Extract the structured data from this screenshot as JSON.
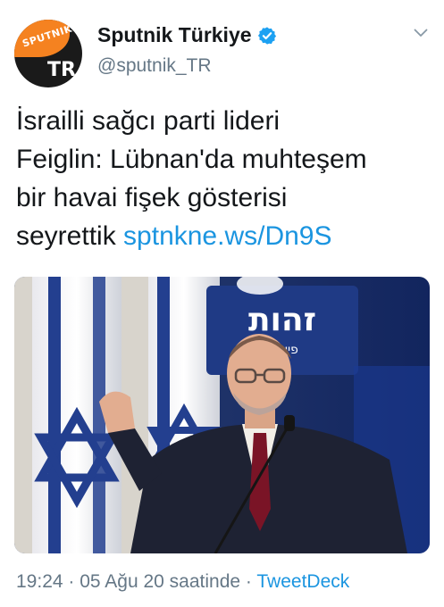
{
  "account": {
    "display_name": "Sputnik Türkiye",
    "handle": "@sputnik_TR",
    "avatar_logo_text": "SPUTNIK",
    "avatar_badge": "TR",
    "verified": true
  },
  "tweet": {
    "text_lines": [
      "İsrailli sağcı parti lideri",
      "Feiglin: Lübnan'da muhteşem",
      "bir havai fişek gösterisi"
    ],
    "last_line_prefix": "seyrettik",
    "link_text": "sptnkne.ws/Dn9S"
  },
  "photo": {
    "banner_text": "זהות",
    "banner_subtext": "פייגלין"
  },
  "meta": {
    "time": "19:24",
    "separator": "·",
    "date": "05 Ağu 20 saatinde",
    "source": "TweetDeck"
  },
  "colors": {
    "link": "#1b95e0",
    "secondary": "#657786",
    "verified": "#1da1f2",
    "brand_orange": "#f58220"
  },
  "icons": {
    "verified": "verified-badge-icon",
    "caret": "chevron-down-icon"
  }
}
